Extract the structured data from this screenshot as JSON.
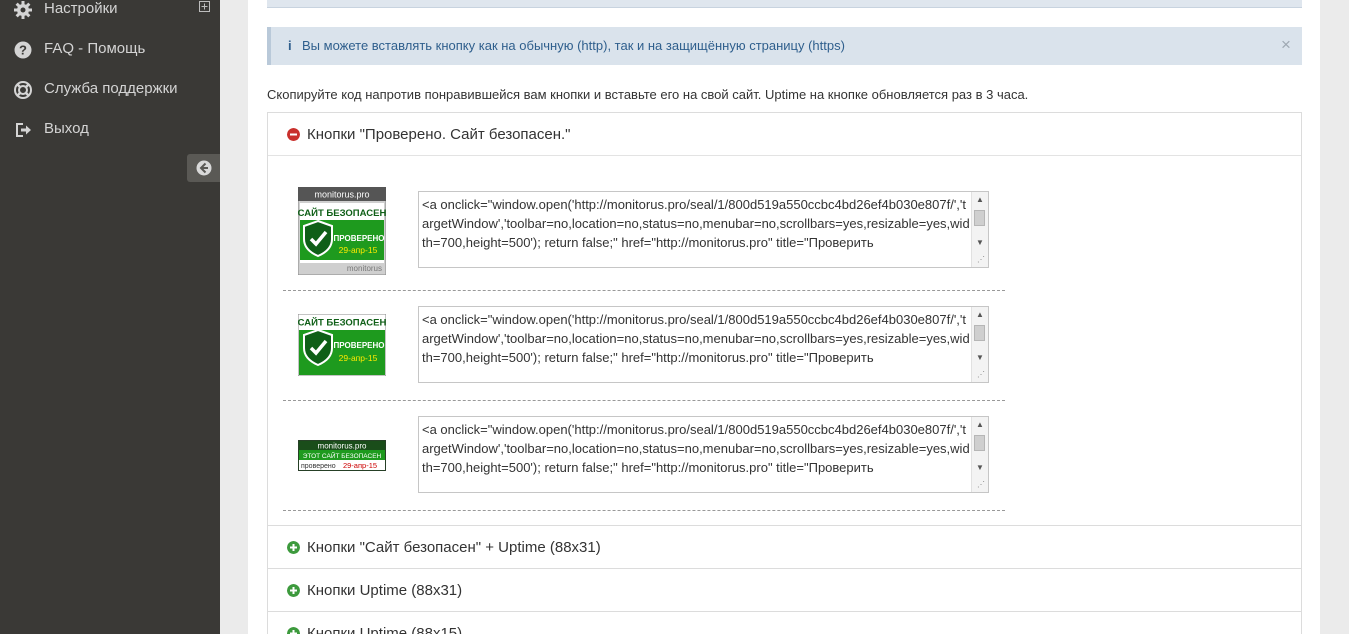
{
  "sidebar": {
    "items": [
      {
        "label": "Настройки",
        "icon": "gear-icon"
      },
      {
        "label": "FAQ - Помощь",
        "icon": "question-icon"
      },
      {
        "label": "Служба поддержки",
        "icon": "lifebuoy-icon"
      },
      {
        "label": "Выход",
        "icon": "sign-out-icon"
      }
    ],
    "expand_icon": "plus-square-icon",
    "collapse_icon": "arrow-left-circle-icon"
  },
  "alert": {
    "icon": "i",
    "text": "Вы можете вставлять кнопку как на обычную (http), так и на защищённую страницу (https)",
    "close": "×"
  },
  "intro": "Скопируйте код напротив понравившейся вам кнопки и вставьте его на свой сайт. Uptime на кнопке обновляется раз в 3 часа.",
  "panels": [
    {
      "title": "Кнопки \"Проверено. Сайт безопасен.\"",
      "state": "expanded"
    },
    {
      "title": "Кнопки \"Сайт безопасен\" + Uptime (88x31)",
      "state": "collapsed"
    },
    {
      "title": "Кнопки Uptime (88x31)",
      "state": "collapsed"
    },
    {
      "title": "Кнопки Uptime (88x15)",
      "state": "collapsed"
    }
  ],
  "badges": {
    "site": "monitorus.pro",
    "safe": "САЙТ БЕЗОПАСЕН",
    "checked": "ПРОВЕРЕНО",
    "date": "29-апр-15",
    "brand": "monitorus",
    "small_safe": "ЭТОТ САЙТ БЕЗОПАСЕН",
    "small_checked": "проверено"
  },
  "code_rows": [
    {
      "code": "<a onclick=\"window.open('http://monitorus.pro/seal/1/800d519a550ccbc4bd26ef4b030e807f/','targetWindow','toolbar=no,location=no,status=no,menubar=no,scrollbars=yes,resizable=yes,width=700,height=500'); return false;\" href=\"http://monitorus.pro\" title=\"Проверить"
    },
    {
      "code": "<a onclick=\"window.open('http://monitorus.pro/seal/1/800d519a550ccbc4bd26ef4b030e807f/','targetWindow','toolbar=no,location=no,status=no,menubar=no,scrollbars=yes,resizable=yes,width=700,height=500'); return false;\" href=\"http://monitorus.pro\" title=\"Проверить"
    },
    {
      "code": "<a onclick=\"window.open('http://monitorus.pro/seal/1/800d519a550ccbc4bd26ef4b030e807f/','targetWindow','toolbar=no,location=no,status=no,menubar=no,scrollbars=yes,resizable=yes,width=700,height=500'); return false;\" href=\"http://monitorus.pro\" title=\"Проверить"
    }
  ],
  "colors": {
    "sidebar_bg": "#3a3936",
    "alert_bg": "#dae3ec",
    "badge_green": "#1e9a1e",
    "badge_dark_green": "#0f5f17",
    "minus_red": "#c9302c",
    "plus_green": "#3d9a3d"
  }
}
